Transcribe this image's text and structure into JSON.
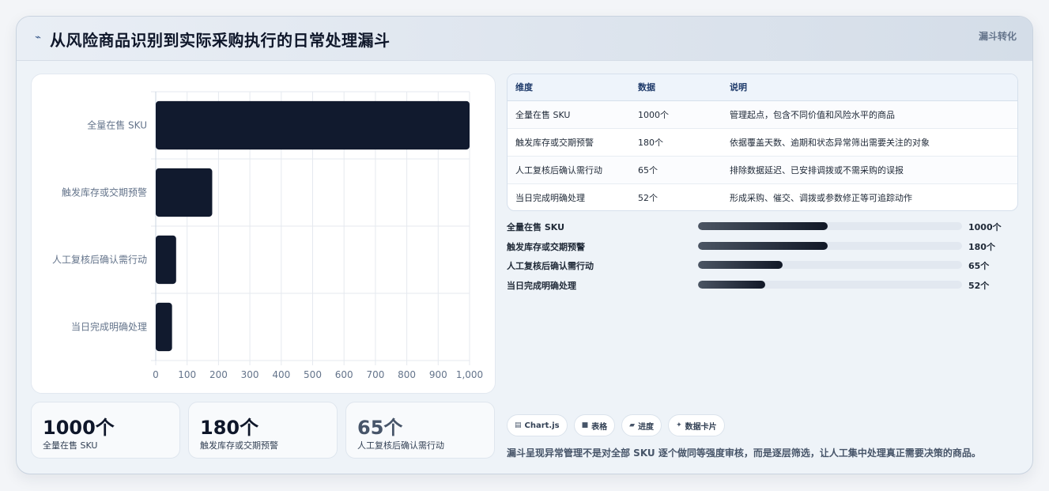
{
  "header": {
    "icon": "trend-icon",
    "title": "从风险商品识别到实际采购执行的日常处理漏斗",
    "tag": "漏斗转化"
  },
  "chart_data": {
    "type": "bar",
    "orientation": "horizontal",
    "categories": [
      "全量在售 SKU",
      "触发库存或交期预警",
      "人工复核后确认需行动",
      "当日完成明确处理"
    ],
    "values": [
      1000,
      180,
      65,
      52
    ],
    "xlim": [
      0,
      1000
    ],
    "xticks": [
      "0",
      "100",
      "200",
      "300",
      "400",
      "500",
      "600",
      "700",
      "800",
      "900",
      "1,000"
    ],
    "grid": true,
    "bar_color": "#111a2e"
  },
  "stats": [
    {
      "value": "1000个",
      "label": "全量在售 SKU"
    },
    {
      "value": "180个",
      "label": "触发库存或交期预警"
    },
    {
      "value": "65个",
      "label": "人工复核后确认需行动"
    }
  ],
  "table": {
    "headers": [
      "维度",
      "数据",
      "说明"
    ],
    "rows": [
      [
        "全量在售 SKU",
        "1000个",
        "管理起点，包含不同价值和风险水平的商品"
      ],
      [
        "触发库存或交期预警",
        "180个",
        "依据覆盖天数、逾期和状态异常筛出需要关注的对象"
      ],
      [
        "人工复核后确认需行动",
        "65个",
        "排除数据延迟、已安排调拨或不需采购的误报"
      ],
      [
        "当日完成明确处理",
        "52个",
        "形成采购、催交、调拨或参数修正等可追踪动作"
      ]
    ]
  },
  "progress": [
    {
      "label": "全量在售 SKU",
      "value": "1000个",
      "fill": 0.49
    },
    {
      "label": "触发库存或交期预警",
      "value": "180个",
      "fill": 0.49
    },
    {
      "label": "人工复核后确认需行动",
      "value": "65个",
      "fill": 0.32
    },
    {
      "label": "当日完成明确处理",
      "value": "52个",
      "fill": 0.255
    }
  ],
  "chips": [
    {
      "icon": "chart-icon",
      "glyph": "▤",
      "label": "Chart.js"
    },
    {
      "icon": "table-icon",
      "glyph": "■",
      "label": "表格"
    },
    {
      "icon": "progress-icon",
      "glyph": "▰",
      "label": "进度"
    },
    {
      "icon": "card-icon",
      "glyph": "✦",
      "label": "数据卡片"
    }
  ],
  "note": "漏斗呈现异常管理不是对全部 SKU 逐个做同等强度审核，而是逐层筛选，让人工集中处理真正需要决策的商品。"
}
